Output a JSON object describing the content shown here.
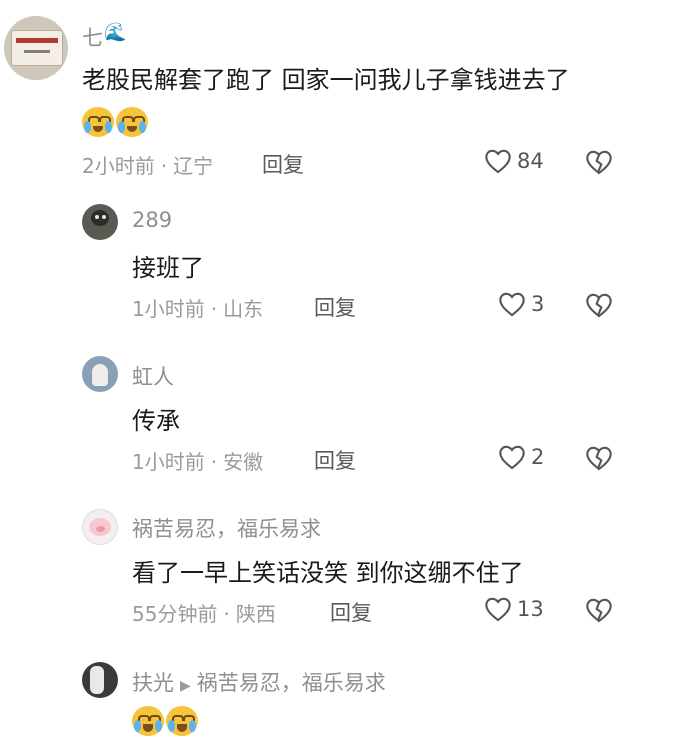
{
  "comments": [
    {
      "name": "七",
      "name_suffix_icon": "wave-icon",
      "text": "老股民解套了跑了 回家一问我儿子拿钱进去了",
      "emojis": [
        "crying-emoji",
        "crying-emoji"
      ],
      "time": "2小时前",
      "location": "辽宁",
      "reply_label": "回复",
      "likes": "84"
    },
    {
      "name": "289",
      "text": "接班了",
      "time": "1小时前",
      "location": "山东",
      "reply_label": "回复",
      "likes": "3"
    },
    {
      "name": "虹人",
      "text": "传承",
      "time": "1小时前",
      "location": "安徽",
      "reply_label": "回复",
      "likes": "2"
    },
    {
      "name": "祸苦易忍，福乐易求",
      "text": "看了一早上笑话没笑 到你这绷不住了",
      "time": "55分钟前",
      "location": "陕西",
      "reply_label": "回复",
      "likes": "13"
    },
    {
      "name": "扶光",
      "reply_to": "祸苦易忍，福乐易求",
      "emojis": [
        "laugh-cry-emoji",
        "laugh-cry-emoji"
      ]
    }
  ],
  "separator": "·"
}
